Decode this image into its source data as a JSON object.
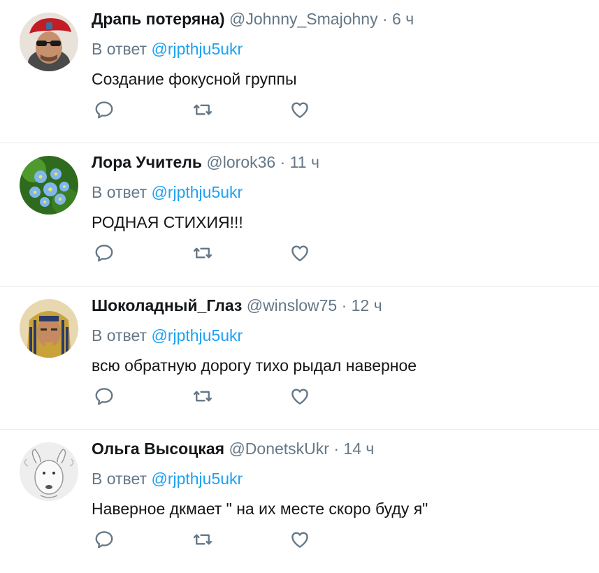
{
  "tweets": [
    {
      "name": "Драпь потеряна)",
      "handle": "@Johnny_Smajohny",
      "dot": "·",
      "time": "6 ч",
      "reply_prefix": "В ответ",
      "reply_to": "@rjpthju5ukr",
      "text": "Создание фокусной группы",
      "avatar": "man-red-beret-sunglasses"
    },
    {
      "name": "Лора Учитель",
      "handle": "@lorok36",
      "dot": "·",
      "time": "11 ч",
      "reply_prefix": "В ответ",
      "reply_to": "@rjpthju5ukr",
      "text": "РОДНАЯ СТИХИЯ!!!",
      "avatar": "blue-forget-me-not-flowers"
    },
    {
      "name": "Шоколадный_Глаз",
      "handle": "@winslow75",
      "dot": "·",
      "time": "12 ч",
      "reply_prefix": "В ответ",
      "reply_to": "@rjpthju5ukr",
      "text": "всю обратную дорогу тихо рыдал наверное",
      "avatar": "man-pharaoh-headdress"
    },
    {
      "name": "Ольга Высоцкая",
      "handle": "@DonetskUkr",
      "dot": "·",
      "time": "14 ч",
      "reply_prefix": "В ответ",
      "reply_to": "@rjpthju5ukr",
      "text": "Наверное дкмает \" на их месте скоро буду я\"",
      "avatar": "bull-terrier-sketch"
    }
  ],
  "icons": {
    "reply": "reply-icon",
    "retweet": "retweet-icon",
    "like": "like-heart-icon"
  },
  "colors": {
    "text_primary": "#14171a",
    "text_secondary": "#657786",
    "link": "#1da1f2",
    "divider": "#e6ecf0",
    "icon": "#657786"
  }
}
